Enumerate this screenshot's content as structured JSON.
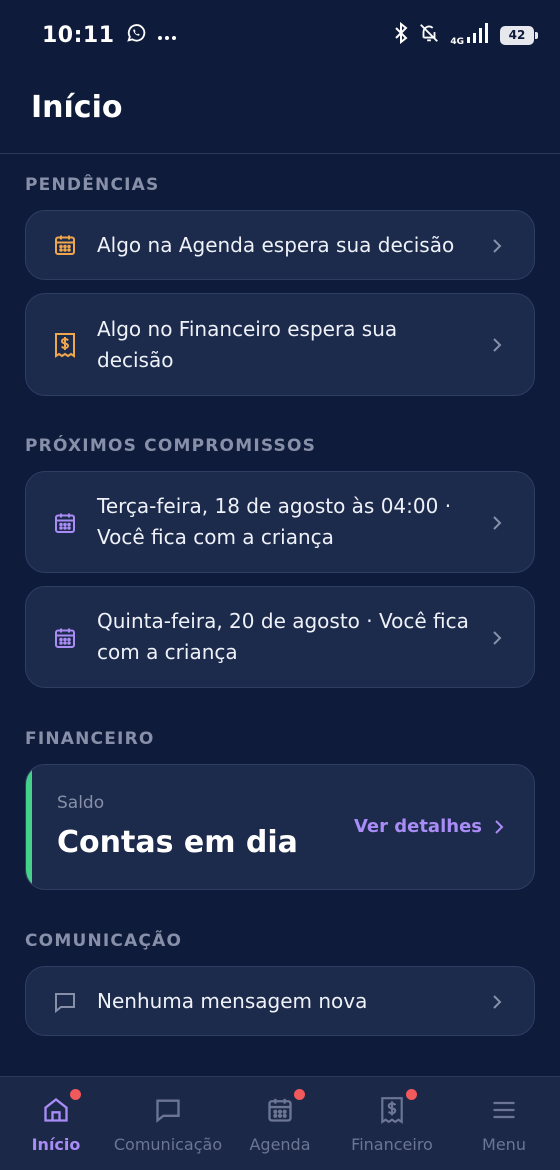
{
  "status_bar": {
    "time": "10:11",
    "network": "4G",
    "battery": "42",
    "icons": [
      "whatsapp-icon",
      "more-icon",
      "bluetooth-icon",
      "bell-off-icon",
      "signal-icon",
      "battery-icon"
    ]
  },
  "header": {
    "title": "Início"
  },
  "sections": {
    "pendencias": {
      "label": "PENDÊNCIAS",
      "items": [
        {
          "icon": "calendar-icon",
          "text": "Algo na Agenda espera sua decisão"
        },
        {
          "icon": "receipt-dollar-icon",
          "text": "Algo no Financeiro espera sua decisão"
        }
      ]
    },
    "compromissos": {
      "label": "PRÓXIMOS COMPROMISSOS",
      "items": [
        {
          "icon": "calendar-icon",
          "text": "Terça-feira, 18 de agosto às 04:00 · Você fica com a criança"
        },
        {
          "icon": "calendar-icon",
          "text": "Quinta-feira, 20 de agosto · Você fica com a criança"
        }
      ]
    },
    "financeiro": {
      "label": "FINANCEIRO",
      "sub": "Saldo",
      "main": "Contas em dia",
      "link": "Ver detalhes"
    },
    "comunicacao": {
      "label": "COMUNICAÇÃO",
      "items": [
        {
          "icon": "message-icon",
          "text": "Nenhuma mensagem nova"
        }
      ]
    }
  },
  "nav": [
    {
      "label": "Início",
      "icon": "home-icon",
      "active": true,
      "badge": true
    },
    {
      "label": "Comunicação",
      "icon": "message-icon",
      "active": false,
      "badge": false
    },
    {
      "label": "Agenda",
      "icon": "calendar-icon",
      "active": false,
      "badge": true
    },
    {
      "label": "Financeiro",
      "icon": "receipt-dollar-icon",
      "active": false,
      "badge": true
    },
    {
      "label": "Menu",
      "icon": "menu-icon",
      "active": false,
      "badge": false
    }
  ],
  "colors": {
    "background": "#0f1b3b",
    "card": "#1c2a4c",
    "accent": "#a98cf5",
    "warning": "#f0a64a",
    "success": "#45d18a",
    "badge": "#f05a5a"
  }
}
